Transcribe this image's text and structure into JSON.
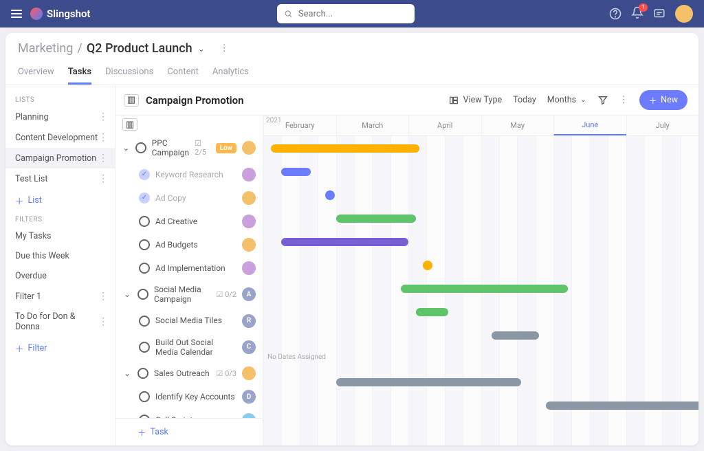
{
  "topbar": {
    "brand": "Slingshot",
    "search_placeholder": "Search...",
    "notif_count": "1"
  },
  "breadcrumb": {
    "root": "Marketing",
    "current": "Q2 Product Launch"
  },
  "tabs": [
    "Overview",
    "Tasks",
    "Discussions",
    "Content",
    "Analytics"
  ],
  "active_tab": 1,
  "sidebar": {
    "lists_header": "LISTS",
    "lists": [
      "Planning",
      "Content Development",
      "Campaign Promotion",
      "Test List"
    ],
    "selected_list": 2,
    "add_list": "List",
    "filters_header": "FILTERS",
    "filters": [
      "My Tasks",
      "Due this Week",
      "Overdue",
      "Filter 1",
      "To Do for Don & Donna"
    ],
    "add_filter": "Filter"
  },
  "list": {
    "title": "Campaign Promotion",
    "toolbar": {
      "viewtype": "View Type",
      "today": "Today",
      "months": "Months",
      "new": "New"
    },
    "year": "2021",
    "months": [
      "February",
      "March",
      "April",
      "May",
      "June",
      "July"
    ],
    "current_month": 4,
    "no_dates": "No Dates Assigned",
    "add_task": "Task",
    "tasks": [
      {
        "name": "PPC Campaign",
        "count": "2/5",
        "tag": "Low",
        "avatar": "b1",
        "group": true,
        "sub": false
      },
      {
        "name": "Keyword Research",
        "done": true,
        "avatar": "b2",
        "sub": true
      },
      {
        "name": "Ad Copy",
        "done": true,
        "avatar": "b1",
        "sub": true
      },
      {
        "name": "Ad Creative",
        "avatar": "b2",
        "sub": true
      },
      {
        "name": "Ad Budgets",
        "avatar": "b1",
        "sub": true
      },
      {
        "name": "Ad Implementation",
        "avatar": "b2",
        "sub": true
      },
      {
        "name": "Social Media Campaign",
        "count": "0/2",
        "avatarLetter": "A",
        "group": true,
        "sub": false
      },
      {
        "name": "Social Media Tiles",
        "avatarLetter": "R",
        "sub": true
      },
      {
        "name": "Build Out Social Media Calendar",
        "avatarLetter": "C",
        "sub": true
      },
      {
        "name": "Sales Outreach",
        "count": "0/3",
        "avatar": "b1",
        "group": true,
        "sub": false
      },
      {
        "name": "Identify Key Accounts",
        "avatarLetter": "D",
        "sub": true
      },
      {
        "name": "Call Scripts",
        "avatar": "b4",
        "sub": true
      }
    ]
  },
  "chart_data": {
    "type": "gantt",
    "x_unit": "month",
    "x_range": [
      "2021-02",
      "2021-07"
    ],
    "rows": [
      {
        "task": "PPC Campaign",
        "start": 0.1,
        "end": 2.15,
        "color": "#ffb100"
      },
      {
        "task": "Keyword Research",
        "start": 0.25,
        "end": 0.65,
        "color": "#6c7bff"
      },
      {
        "task": "Ad Copy",
        "point": 0.85,
        "color": "#6c7bff"
      },
      {
        "task": "Ad Creative",
        "start": 1.0,
        "end": 2.1,
        "color": "#5fc36a"
      },
      {
        "task": "Ad Budgets",
        "start": 0.25,
        "end": 2.0,
        "color": "#7b5dd6"
      },
      {
        "task": "Ad Implementation",
        "point": 2.2,
        "color": "#ffb100"
      },
      {
        "task": "Social Media Campaign",
        "start": 1.9,
        "end": 4.2,
        "color": "#5fc36a"
      },
      {
        "task": "Social Media Tiles",
        "start": 2.1,
        "end": 2.55,
        "color": "#5fc36a"
      },
      {
        "task": "Build Out Social Media Calendar",
        "start": 3.15,
        "end": 3.8,
        "color": "#8b97a5"
      },
      {
        "task": "Sales Outreach",
        "no_dates": true
      },
      {
        "task": "Identify Key Accounts",
        "start": 1.0,
        "end": 3.55,
        "color": "#8b97a5"
      },
      {
        "task": "Call Scripts",
        "start": 3.9,
        "end": 6.1,
        "color": "#8b97a5"
      }
    ]
  }
}
